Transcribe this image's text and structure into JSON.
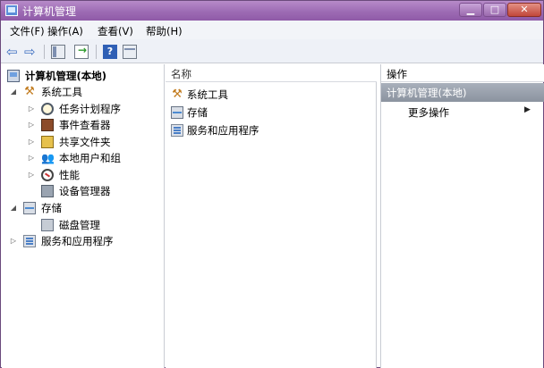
{
  "window": {
    "title": "计算机管理",
    "minimize": "▁",
    "maximize": "□",
    "close": "✕"
  },
  "menu": {
    "items": [
      "文件(F)",
      "操作(A)",
      "查看(V)",
      "帮助(H)"
    ]
  },
  "toolbar": {
    "icons": [
      "back-arrow-icon",
      "forward-arrow-icon",
      "show-hide-tree-icon",
      "export-list-icon",
      "help-icon",
      "action-pane-icon"
    ],
    "back_glyph": "⇦",
    "forward_glyph": "⇨",
    "help_glyph": "?"
  },
  "tree": {
    "root": "计算机管理(本地)",
    "items": [
      {
        "label": "系统工具",
        "icon": "tools-icon",
        "expanded": true
      },
      {
        "label": "任务计划程序",
        "icon": "clock-icon"
      },
      {
        "label": "事件查看器",
        "icon": "event-viewer-icon"
      },
      {
        "label": "共享文件夹",
        "icon": "shared-folder-icon"
      },
      {
        "label": "本地用户和组",
        "icon": "users-icon"
      },
      {
        "label": "性能",
        "icon": "performance-icon"
      },
      {
        "label": "设备管理器",
        "icon": "device-manager-icon"
      },
      {
        "label": "存储",
        "icon": "storage-icon",
        "expanded": true
      },
      {
        "label": "磁盘管理",
        "icon": "disk-icon"
      },
      {
        "label": "服务和应用程序",
        "icon": "services-icon"
      }
    ]
  },
  "middle": {
    "column_header": "名称",
    "items": [
      {
        "label": "系统工具",
        "icon": "tools-icon"
      },
      {
        "label": "存储",
        "icon": "storage-icon"
      },
      {
        "label": "服务和应用程序",
        "icon": "services-icon"
      }
    ]
  },
  "actions": {
    "header": "操作",
    "section": "计算机管理(本地)",
    "more": "更多操作",
    "more_arrow": "▶"
  },
  "colors": {
    "titlebar": "#9d6bb4",
    "section_bar": "#8b939f"
  }
}
